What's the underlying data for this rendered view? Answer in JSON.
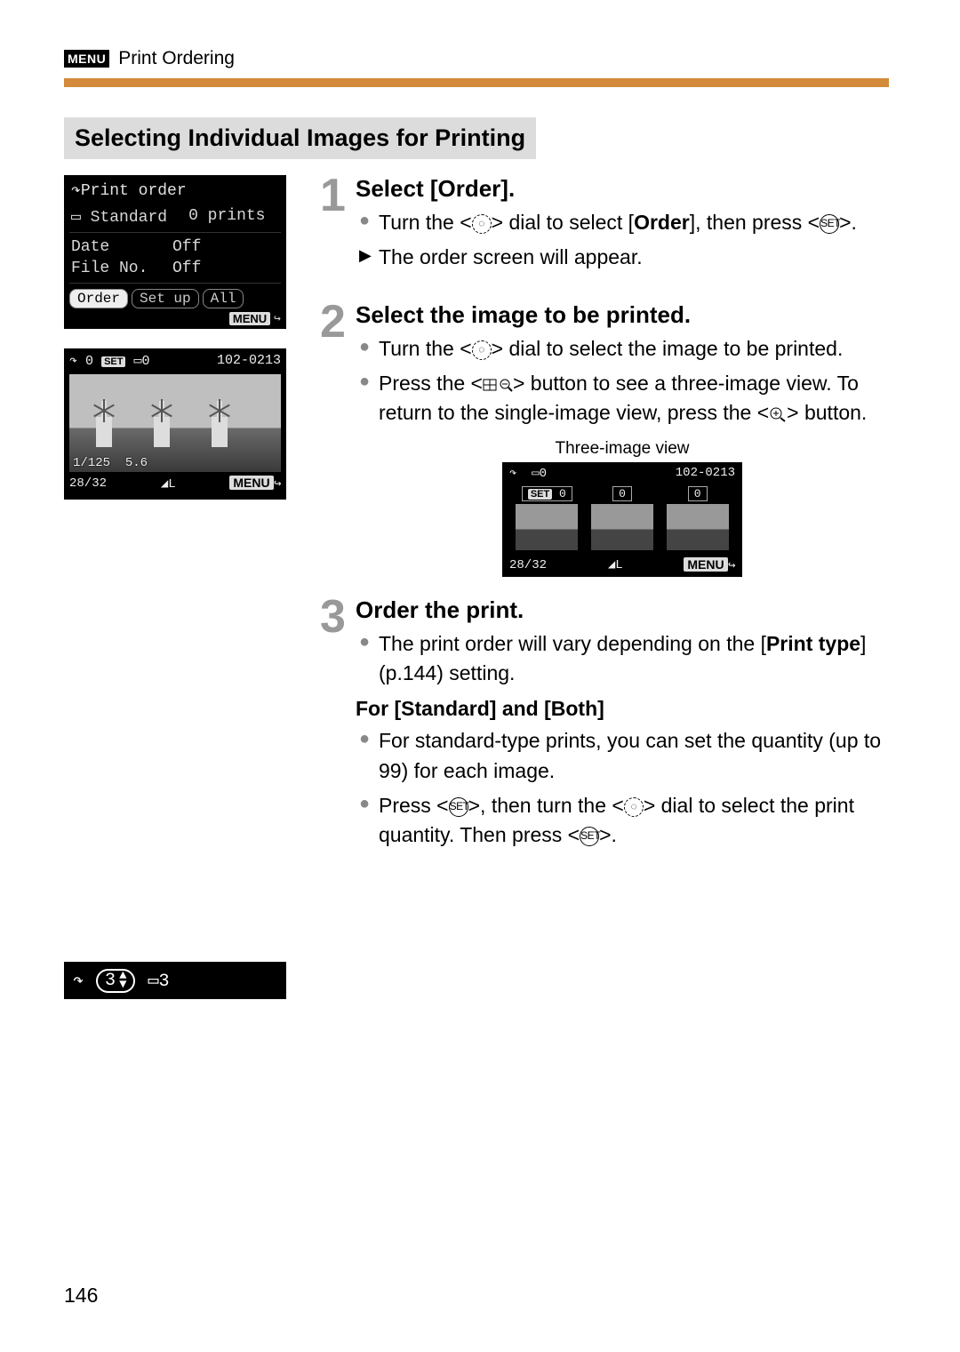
{
  "header": {
    "menu_badge": "MENU",
    "breadcrumb": "Print Ordering"
  },
  "subheading": "Selecting Individual Images for Printing",
  "lcd1": {
    "title": "Print order",
    "type_label": "Standard",
    "prints_label": "0 prints",
    "date_label": "Date",
    "date_value": "Off",
    "fileno_label": "File No.",
    "fileno_value": "Off",
    "tab_order": "Order",
    "tab_setup": "Set up",
    "tab_all": "All",
    "menu_label": "MENU"
  },
  "lcd2": {
    "set_count": "0",
    "set_label": "SET",
    "card_count": "0",
    "folder": "102-0213",
    "shutter": "1/125",
    "aperture": "5.6",
    "counter": "28/32",
    "quality": "L",
    "menu_label": "MENU"
  },
  "steps": {
    "s1": {
      "num": "1",
      "title": "Select [Order].",
      "b1a": "Turn the <",
      "b1b": "> dial to select [",
      "b1c": "Order",
      "b1d": "], then press <",
      "b1e": ">.",
      "b2": "The order screen will appear."
    },
    "s2": {
      "num": "2",
      "title": "Select the image to be printed.",
      "b1a": "Turn the <",
      "b1b": "> dial to select the image to be printed.",
      "b2a": "Press the <",
      "b2b": "> button to see a three-image view. To return to the single-image view, press the <",
      "b2c": "> button.",
      "caption": "Three-image view"
    },
    "s3": {
      "num": "3",
      "title": "Order the print.",
      "b1a": "The print order will vary depending on the [",
      "b1b": "Print type",
      "b1c": "] (p.144) setting.",
      "sub": "For [Standard] and [Both]",
      "b2": "For standard-type prints, you can set the quantity (up to 99) for each image.",
      "b3a": "Press <",
      "b3b": ">, then turn the <",
      "b3c": "> dial to select the print quantity. Then press <",
      "b3d": ">."
    }
  },
  "three_view": {
    "card_count": "0",
    "folder": "102-0213",
    "set_label": "SET",
    "c0": "0",
    "c1": "0",
    "c2": "0",
    "counter": "28/32",
    "quality": "L",
    "menu_label": "MENU"
  },
  "strip": {
    "qty": "3",
    "card": "3"
  },
  "page_number": "146"
}
